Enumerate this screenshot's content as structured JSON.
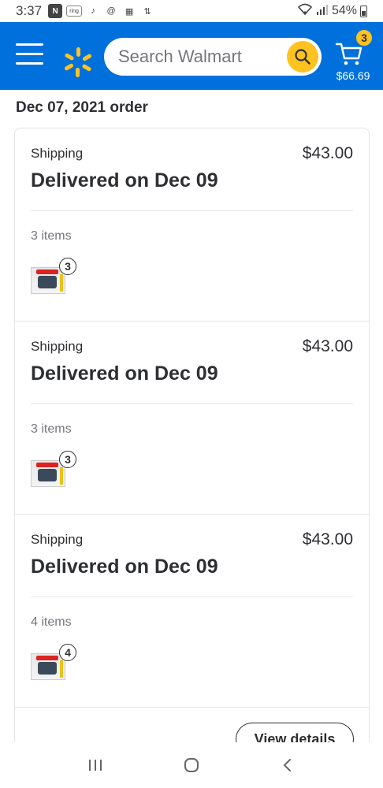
{
  "status_bar": {
    "time": "3:37",
    "battery": "54%",
    "icons": [
      "nova-icon",
      "ring-icon",
      "tiktok-icon",
      "threads-icon",
      "page-icon",
      "retweet-icon"
    ]
  },
  "header": {
    "search_placeholder": "Search Walmart",
    "cart_count": "3",
    "cart_total": "$66.69",
    "brand_color": "#0071dc",
    "accent_color": "#ffc220"
  },
  "order": {
    "title": "Dec 07, 2021 order",
    "shipments": [
      {
        "label": "Shipping",
        "price": "$43.00",
        "status": "Delivered on Dec 09",
        "items": "3 items",
        "qty": "3"
      },
      {
        "label": "Shipping",
        "price": "$43.00",
        "status": "Delivered on Dec 09",
        "items": "3 items",
        "qty": "3"
      },
      {
        "label": "Shipping",
        "price": "$43.00",
        "status": "Delivered on Dec 09",
        "items": "4 items",
        "qty": "4"
      }
    ],
    "view_details_label": "View details"
  },
  "nav_bar": {
    "buttons": [
      "recents-button",
      "home-button",
      "back-button"
    ]
  }
}
